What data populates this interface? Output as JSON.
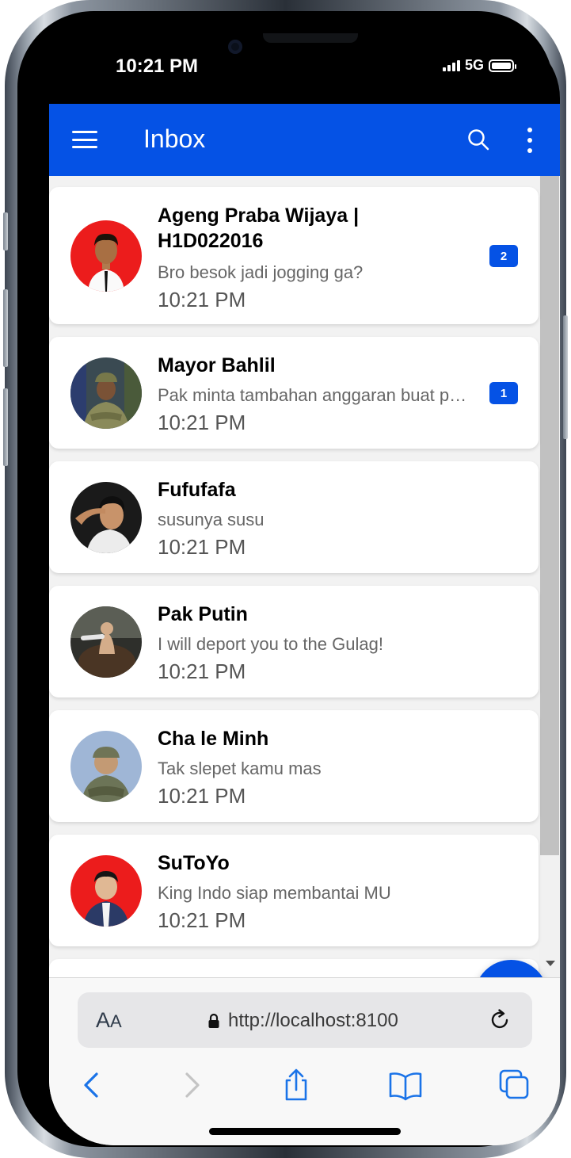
{
  "status_bar": {
    "time": "10:21 PM",
    "network": "5G"
  },
  "toolbar": {
    "title": "Inbox"
  },
  "chats": [
    {
      "name": "Ageng Praba Wijaya | H1D022016",
      "message": "Bro besok jadi jogging ga?",
      "time": "10:21 PM",
      "unread": "2"
    },
    {
      "name": "Mayor Bahlil",
      "message": "Pak minta tambahan anggaran buat proyek",
      "time": "10:21 PM",
      "unread": "1"
    },
    {
      "name": "Fufufafa",
      "message": "susunya susu",
      "time": "10:21 PM",
      "unread": ""
    },
    {
      "name": "Pak Putin",
      "message": "I will deport you to the Gulag!",
      "time": "10:21 PM",
      "unread": ""
    },
    {
      "name": "Cha le Minh",
      "message": "Tak slepet kamu mas",
      "time": "10:21 PM",
      "unread": ""
    },
    {
      "name": "SuToYo",
      "message": "King Indo siap membantai MU",
      "time": "10:21 PM",
      "unread": ""
    }
  ],
  "browser": {
    "aa_label": "A",
    "aa_small": "A",
    "url": "http://localhost:8100"
  },
  "colors": {
    "primary": "#0552e5",
    "background": "#f2f2f2"
  },
  "icons": [
    "menu-icon",
    "search-icon",
    "more-vertical-icon",
    "chat-bubble-icon",
    "lock-icon",
    "reload-icon",
    "back-icon",
    "forward-icon",
    "share-icon",
    "bookmarks-icon",
    "tabs-icon"
  ]
}
